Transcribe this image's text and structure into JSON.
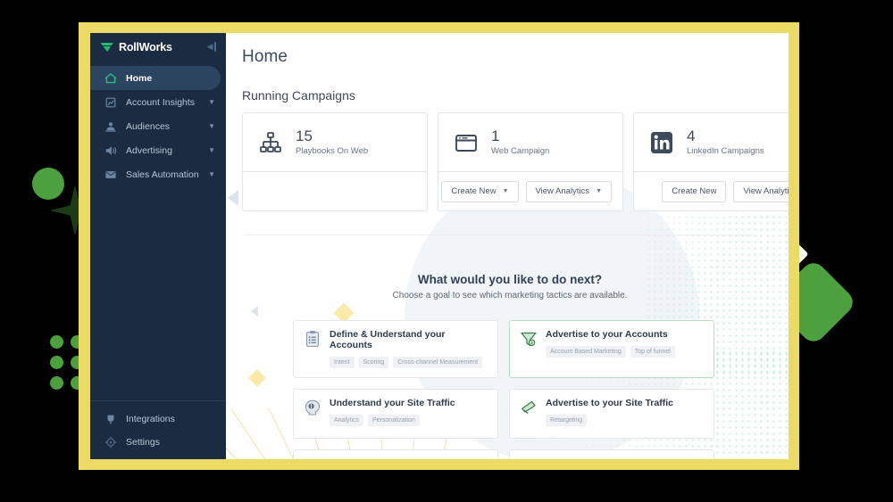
{
  "app": {
    "brand": "RollWorks",
    "collapse_icon": "collapse-sidebar-icon"
  },
  "sidebar": {
    "items": [
      {
        "label": "Home",
        "icon": "home-icon",
        "active": true,
        "expandable": false
      },
      {
        "label": "Account Insights",
        "icon": "chart-icon",
        "active": false,
        "expandable": true
      },
      {
        "label": "Audiences",
        "icon": "people-icon",
        "active": false,
        "expandable": true
      },
      {
        "label": "Advertising",
        "icon": "megaphone-icon",
        "active": false,
        "expandable": true
      },
      {
        "label": "Sales Automation",
        "icon": "envelope-icon",
        "active": false,
        "expandable": true
      }
    ],
    "bottom_items": [
      {
        "label": "Integrations",
        "icon": "plug-icon"
      },
      {
        "label": "Settings",
        "icon": "gear-icon"
      }
    ]
  },
  "main": {
    "page_title": "Home",
    "section_title": "Running Campaigns",
    "stat_cards": [
      {
        "icon": "sitemap-icon",
        "value": "15",
        "label": "Playbooks On Web",
        "actions": []
      },
      {
        "icon": "browser-window-icon",
        "value": "1",
        "label": "Web Campaign",
        "actions": [
          {
            "label": "Create New",
            "caret": "▾"
          },
          {
            "label": "View Analytics",
            "caret": "▾"
          }
        ]
      },
      {
        "icon": "linkedin-icon",
        "value": "4",
        "label": "LinkedIn Campaigns",
        "actions": [
          {
            "label": "Create New",
            "caret": ""
          },
          {
            "label": "View Analytics",
            "caret": ""
          }
        ]
      }
    ],
    "hero": {
      "heading": "What would you like to do next?",
      "subheading": "Choose a goal to see which marketing tactics are available."
    },
    "goal_cards": [
      {
        "icon": "clipboard-icon",
        "title": "Define & Understand your Accounts",
        "tags": [
          "Intent",
          "Scoring",
          "Cross-channel Measurement"
        ],
        "highlighted": false
      },
      {
        "icon": "funnel-icon",
        "title": "Advertise to your Accounts",
        "tags": [
          "Account Based Marketing",
          "Top of funnel"
        ],
        "highlighted": true
      },
      {
        "icon": "head-profile-icon",
        "title": "Understand your Site Traffic",
        "tags": [
          "Analytics",
          "Personalization"
        ],
        "highlighted": false
      },
      {
        "icon": "bullhorn-icon",
        "title": "Advertise to your Site Traffic",
        "tags": [
          "Retargeting"
        ],
        "highlighted": false
      }
    ]
  },
  "colors": {
    "frame_yellow": "#EBDA63",
    "sidebar_navy": "#1B2C42",
    "sidebar_active": "#2B4560",
    "brand_green": "#4CA13E",
    "logo_green": "#1DBF73",
    "text_dark": "#3E4A5C",
    "tag_bg": "#EFF1F4",
    "dot_teal": "#C7EDE2"
  }
}
